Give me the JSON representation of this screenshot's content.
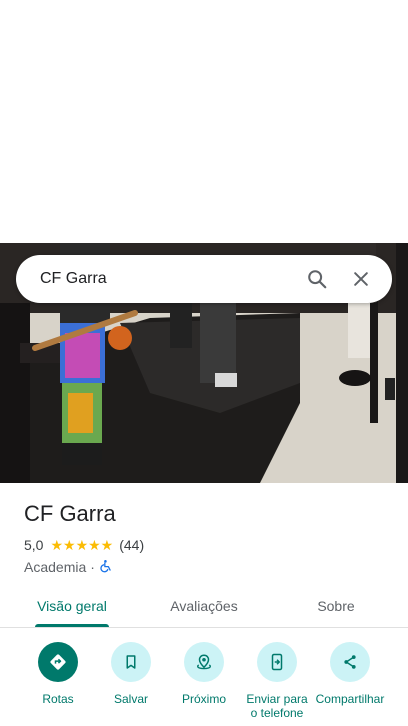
{
  "search": {
    "query": "CF Garra",
    "search_icon": "search-icon",
    "clear_icon": "close-icon"
  },
  "place": {
    "name": "CF Garra",
    "rating": "5,0",
    "stars": "★★★★★",
    "review_count": "(44)",
    "category": "Academia",
    "separator": "·",
    "accessibility_icon": "wheelchair-icon"
  },
  "tabs": [
    {
      "label": "Visão geral",
      "active": true
    },
    {
      "label": "Avaliações",
      "active": false
    },
    {
      "label": "Sobre",
      "active": false
    }
  ],
  "actions": [
    {
      "label": "Rotas",
      "icon": "directions-icon"
    },
    {
      "label": "Salvar",
      "icon": "bookmark-icon"
    },
    {
      "label": "Próximo",
      "icon": "nearby-icon"
    },
    {
      "label": "Enviar para o telefone",
      "icon": "send-to-phone-icon"
    },
    {
      "label": "Compartilhar",
      "icon": "share-icon"
    }
  ],
  "colors": {
    "accent": "#00796b",
    "action_bg": "#ccf3f6",
    "star": "#fbbc04"
  }
}
